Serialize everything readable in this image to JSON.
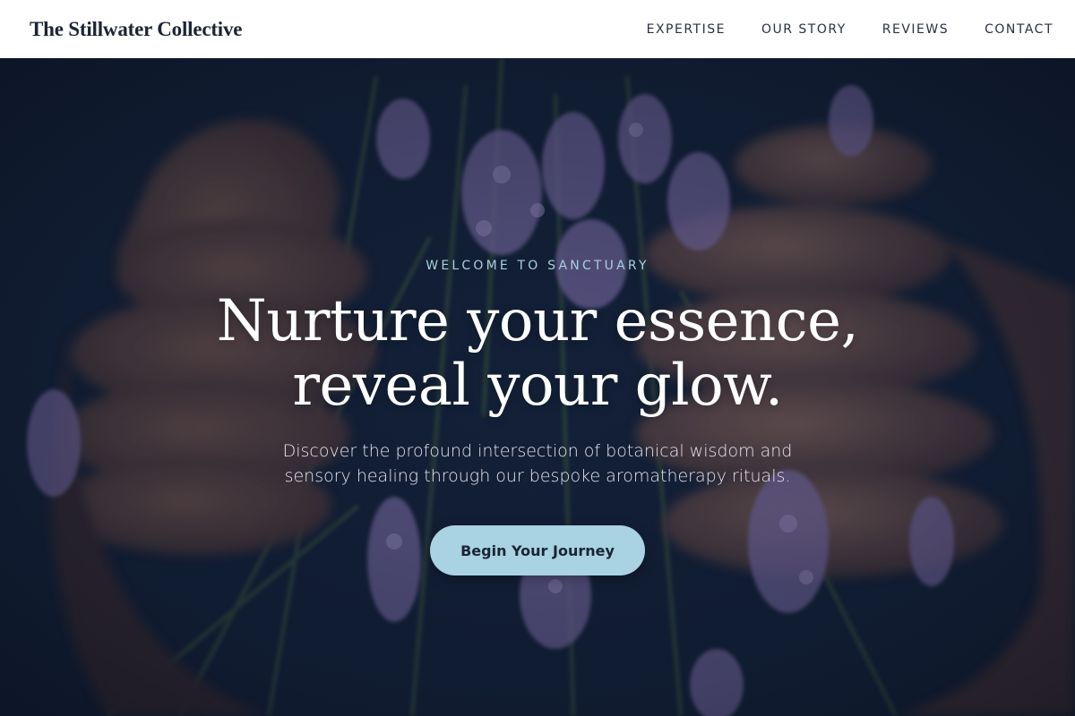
{
  "header": {
    "brand": "The Stillwater Collective",
    "nav": [
      {
        "label": "EXPERTISE"
      },
      {
        "label": "OUR STORY"
      },
      {
        "label": "REVIEWS"
      },
      {
        "label": "CONTACT"
      }
    ]
  },
  "hero": {
    "eyebrow": "WELCOME TO SANCTUARY",
    "headline_line1": "Nurture your essence,",
    "headline_line2": "reveal your glow.",
    "subtitle": "Discover the profound intersection of botanical wisdom and sensory healing through our bespoke aromatherapy rituals.",
    "cta_label": "Begin Your Journey"
  },
  "colors": {
    "header_bg": "#ffffff",
    "brand_text": "#1b2533",
    "eyebrow": "#a9cfe0",
    "cta_bg": "#a9d2e2",
    "cta_text": "#1a2535",
    "hero_overlay": "#0f1b2b"
  }
}
